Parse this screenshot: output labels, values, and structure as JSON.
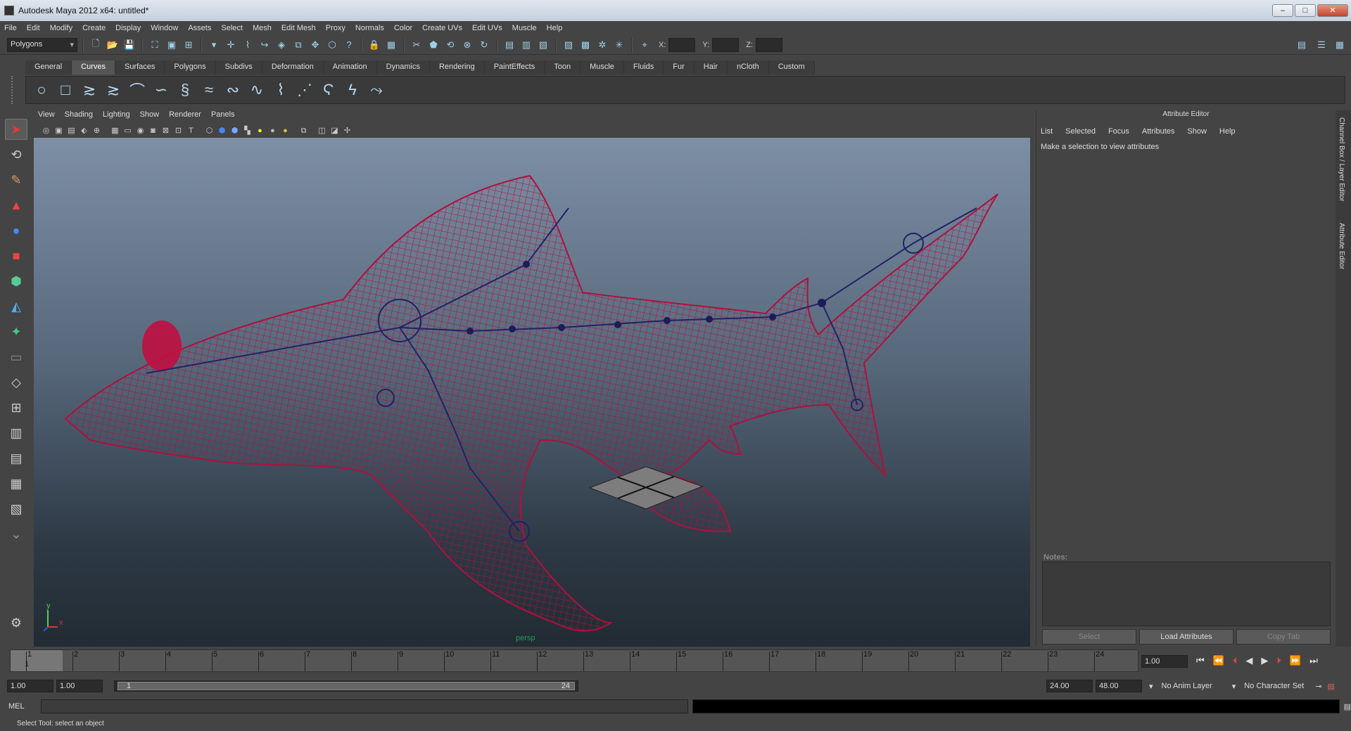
{
  "window": {
    "title": "Autodesk Maya 2012 x64: untitled*",
    "min": "–",
    "max": "□",
    "close": "✕"
  },
  "menubar": [
    "File",
    "Edit",
    "Modify",
    "Create",
    "Display",
    "Window",
    "Assets",
    "Select",
    "Mesh",
    "Edit Mesh",
    "Proxy",
    "Normals",
    "Color",
    "Create UVs",
    "Edit UVs",
    "Muscle",
    "Help"
  ],
  "status": {
    "menuset": "Polygons",
    "x_label": "X:",
    "y_label": "Y:",
    "z_label": "Z:"
  },
  "shelf_tabs": [
    "General",
    "Curves",
    "Surfaces",
    "Polygons",
    "Subdivs",
    "Deformation",
    "Animation",
    "Dynamics",
    "Rendering",
    "PaintEffects",
    "Toon",
    "Muscle",
    "Fluids",
    "Fur",
    "Hair",
    "nCloth",
    "Custom"
  ],
  "active_shelf": "Curves",
  "panel_menu": [
    "View",
    "Shading",
    "Lighting",
    "Show",
    "Renderer",
    "Panels"
  ],
  "viewport": {
    "camera": "persp",
    "axis_y": "y",
    "axis_x": "x"
  },
  "attribute_editor": {
    "title": "Attribute Editor",
    "menu": [
      "List",
      "Selected",
      "Focus",
      "Attributes",
      "Show",
      "Help"
    ],
    "message": "Make a selection to view attributes",
    "notes_label": "Notes:",
    "buttons": {
      "select": "Select",
      "load": "Load Attributes",
      "copy": "Copy Tab"
    }
  },
  "side_tabs": {
    "channel": "Channel Box / Layer Editor",
    "attr": "Attribute Editor"
  },
  "timeline": {
    "ticks": [
      "1",
      "2",
      "3",
      "4",
      "5",
      "6",
      "7",
      "8",
      "9",
      "10",
      "11",
      "12",
      "13",
      "14",
      "15",
      "16",
      "17",
      "18",
      "19",
      "20",
      "21",
      "22",
      "23",
      "24"
    ],
    "current_frame": "1",
    "current_field": "1.00"
  },
  "range": {
    "start": "1.00",
    "anim_start": "1.00",
    "slider_start": "1",
    "slider_end": "24",
    "end": "24.00",
    "anim_end": "48.00",
    "anim_layer": "No Anim Layer",
    "char_set": "No Character Set"
  },
  "cmd": {
    "label": "MEL"
  },
  "help_line": "Select Tool: select an object"
}
